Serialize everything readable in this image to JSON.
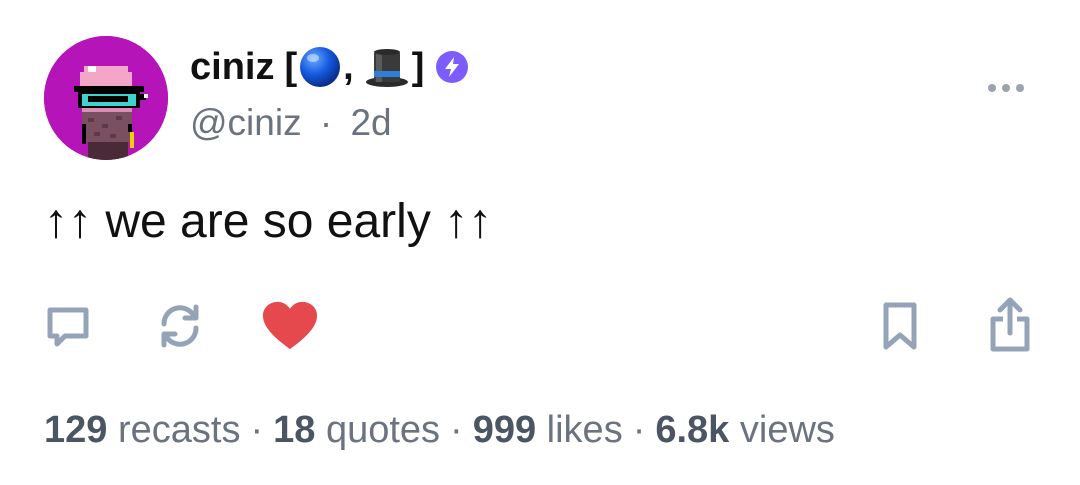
{
  "author": {
    "name": "ciniz",
    "bracket_open": "[",
    "separator": ",",
    "bracket_close": "]",
    "handle": "@ciniz",
    "time_separator": "·",
    "timestamp": "2d",
    "avatar_background": "#b414b8",
    "badge_color": "#7c5cfc"
  },
  "post": {
    "text": "↑↑ we are so early ↑↑"
  },
  "actions": {
    "reply_icon": "comment-icon",
    "recast_icon": "recast-icon",
    "like_icon": "heart-icon",
    "like_color": "#e5484d",
    "bookmark_icon": "bookmark-icon",
    "share_icon": "share-icon",
    "icon_color": "#94a3b8"
  },
  "stats": {
    "recasts_count": "129",
    "recasts_label": "recasts",
    "quotes_count": "18",
    "quotes_label": "quotes",
    "likes_count": "999",
    "likes_label": "likes",
    "views_count": "6.8k",
    "views_label": "views",
    "separator": "·"
  }
}
